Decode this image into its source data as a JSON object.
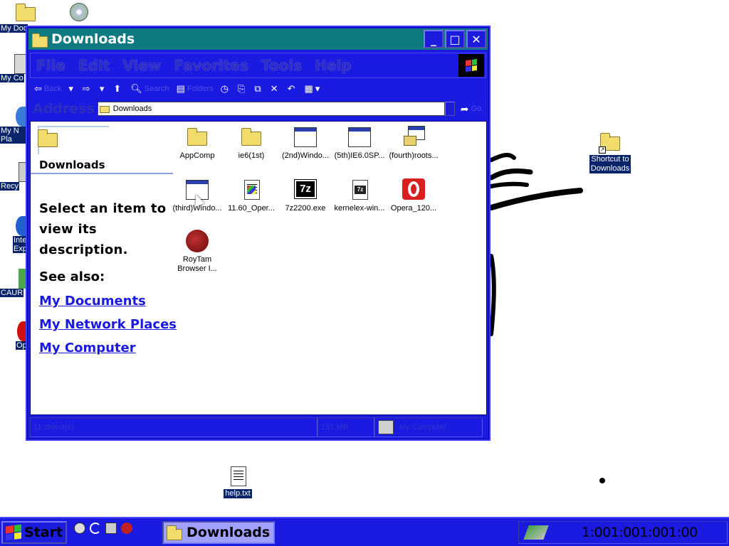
{
  "desktop": {
    "left_icons": [
      {
        "label": "My Doc",
        "icon": "folder-icon"
      },
      {
        "label": "My Co",
        "icon": "computer-icon"
      },
      {
        "label": "My N Pla",
        "icon": "network-icon"
      },
      {
        "label": "Recy",
        "icon": "recycle-bin-icon"
      },
      {
        "label": "Inte Exp",
        "icon": "internet-explorer-icon"
      },
      {
        "label": "CAUR",
        "icon": "program-icon"
      },
      {
        "label": "Op",
        "icon": "opera-icon"
      }
    ],
    "top_icon": {
      "icon": "cd-icon"
    },
    "shortcut": {
      "label_line1": "Shortcut to",
      "label_line2": "Downloads"
    },
    "help": {
      "label": "help.txt"
    }
  },
  "window": {
    "title": "Downloads",
    "menu": [
      "File",
      "Edit",
      "View",
      "Favorites",
      "Tools",
      "Help"
    ],
    "toolbar": {
      "back": "Back",
      "search": "Search",
      "folders": "Folders"
    },
    "address": {
      "label": "Address",
      "value": "Downloads",
      "go": "Go"
    },
    "left_pane": {
      "title": "Downloads",
      "description": "Select an item to view its description.",
      "see_also": "See also:",
      "links": [
        "My Documents",
        "My Network Places",
        "My Computer"
      ]
    },
    "files": [
      {
        "label": "AppComp",
        "icon": "folder-icon"
      },
      {
        "label": "ie6(1st)",
        "icon": "folder-icon"
      },
      {
        "label": "(2nd)Windo...",
        "icon": "window-icon"
      },
      {
        "label": "(5th)IE6.0SP...",
        "icon": "window-icon"
      },
      {
        "label": "(fourth)roots...",
        "icon": "installer-icon"
      },
      {
        "label": "(third)Windo...",
        "icon": "window-icon"
      },
      {
        "label": "11.60_Oper...",
        "icon": "setup-icon"
      },
      {
        "label": "7z2200.exe",
        "icon": "7zip-icon"
      },
      {
        "label": "kernelex-win...",
        "icon": "7zip-doc-icon"
      },
      {
        "label": "Opera_120...",
        "icon": "opera-icon"
      },
      {
        "label": "RoyTam Browser I...",
        "icon": "browser-icon"
      }
    ],
    "status": {
      "objects": "11 object(s)",
      "size": "131 MB",
      "zone": "My Computer"
    }
  },
  "taskbar": {
    "start": "Start",
    "task": "Downloads",
    "clock": "1:001:001:001:00"
  },
  "colors": {
    "window_blue": "#1a1ae0",
    "title_teal": "#0c7a80",
    "link": "#1a1ae0"
  }
}
